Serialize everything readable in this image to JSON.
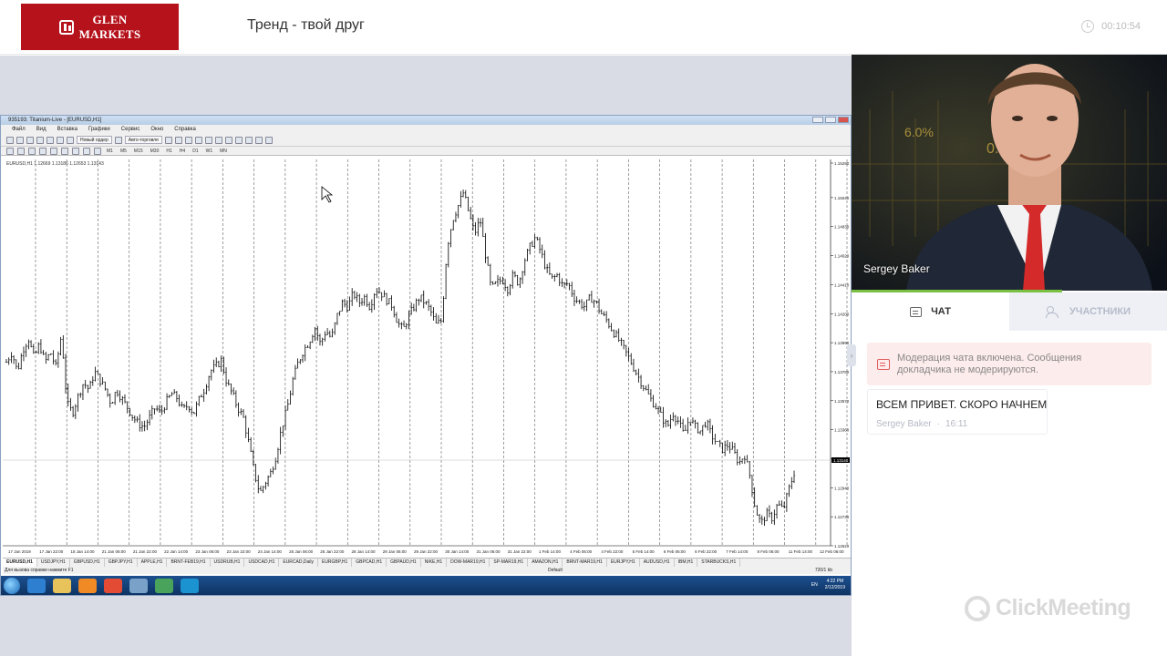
{
  "header": {
    "logo_line1": "GLEN",
    "logo_line2": "MARKETS",
    "title": "Тренд - твой друг",
    "timer": "00:10:54",
    "timer_icon": "clock-icon"
  },
  "terminal": {
    "window_title": "935193: Titanium-Live - [EURUSD,H1]",
    "menu": [
      "Файл",
      "Вид",
      "Вставка",
      "Графики",
      "Сервис",
      "Окно",
      "Справка"
    ],
    "toolbar": {
      "new_order": "Новый ордер",
      "auto_trading": "Авто-торговля"
    },
    "timeframes": [
      "M1",
      "M5",
      "M15",
      "M30",
      "H1",
      "H4",
      "D1",
      "W1",
      "MN"
    ],
    "chart_info": "EURUSD,H1 1.12669 1.13186 1.12653 1.13143",
    "symbol_tabs": [
      "EURUSD,H1",
      "USDJPY,H1",
      "GBPUSD,H1",
      "GBPJPY,H1",
      "APPLE,H1",
      "BRNT-FEB19,H1",
      "USDRUB,H1",
      "USDCAD,H1",
      "EURCAD,Daily",
      "EURGBP,H1",
      "GBPCAD,H1",
      "GBPAUD,H1",
      "NIKE,H1",
      "DOW-MAR19,H1",
      "SP-MAR19,H1",
      "AMAZON,H1",
      "BRNT-MAR19,H1",
      "EURJPY,H1",
      "AUDUSD,H1",
      "IBM,H1",
      "STARBUCKS,H1"
    ],
    "status_help": "Для вызова справки нажмите F1",
    "status_profile": "Default",
    "status_traffic": "720/1 kb",
    "tray_lang": "EN",
    "tray_time": "4:22 PM",
    "tray_date": "2/12/2019"
  },
  "chart_data": {
    "type": "line",
    "series_kind": "ohlc-bars",
    "y_ticks": [
      1.1529,
      1.1504,
      1.1483,
      1.1462,
      1.1441,
      1.142,
      1.1399,
      1.1378,
      1.1357,
      1.1336,
      1.1315,
      1.1294,
      1.1273,
      1.1252
    ],
    "x_ticks": [
      "17 Jan 2019",
      "17 Jan 22:00",
      "18 Jan 14:00",
      "21 Jan 06:00",
      "21 Jan 22:00",
      "22 Jan 14:00",
      "23 Jan 06:00",
      "23 Jan 22:00",
      "24 Jan 14:00",
      "25 Jan 06:00",
      "25 Jan 22:00",
      "28 Jan 14:00",
      "29 Jan 06:00",
      "29 Jan 22:00",
      "30 Jan 14:00",
      "31 Jan 06:00",
      "31 Jan 22:00",
      "1 Feb 14:00",
      "4 Feb 06:00",
      "4 Feb 22:00",
      "5 Feb 14:00",
      "6 Feb 06:00",
      "6 Feb 22:00",
      "7 Feb 14:00",
      "8 Feb 06:00",
      "11 Feb 14:00",
      "12 Feb 06:00"
    ],
    "close_values": [
      1.1385,
      1.1392,
      1.1378,
      1.1394,
      1.1402,
      1.1388,
      1.1398,
      1.1385,
      1.1392,
      1.1381,
      1.1405,
      1.1355,
      1.1348,
      1.136,
      1.137,
      1.1365,
      1.1378,
      1.1372,
      1.1365,
      1.1355,
      1.1365,
      1.1358,
      1.1352,
      1.1345,
      1.134,
      1.1338,
      1.1345,
      1.1352,
      1.1348,
      1.1356,
      1.1362,
      1.1359,
      1.135,
      1.1354,
      1.1348,
      1.1358,
      1.1366,
      1.1378,
      1.1382,
      1.1386,
      1.137,
      1.1362,
      1.1352,
      1.1345,
      1.1326,
      1.1305,
      1.129,
      1.1298,
      1.1305,
      1.1318,
      1.1338,
      1.1352,
      1.1372,
      1.1385,
      1.1394,
      1.14,
      1.141,
      1.1398,
      1.1408,
      1.1402,
      1.1418,
      1.1428,
      1.1425,
      1.1435,
      1.1428,
      1.1432,
      1.1425,
      1.1438,
      1.1435,
      1.143,
      1.1426,
      1.1414,
      1.1408,
      1.1418,
      1.1425,
      1.1432,
      1.1428,
      1.1422,
      1.1412,
      1.1415,
      1.1468,
      1.1488,
      1.1498,
      1.1508,
      1.1492,
      1.1478,
      1.1488,
      1.1462,
      1.1438,
      1.1442,
      1.1445,
      1.1438,
      1.1448,
      1.1442,
      1.1458,
      1.1468,
      1.1475,
      1.1465,
      1.1452,
      1.1445,
      1.1448,
      1.144,
      1.1442,
      1.1432,
      1.1428,
      1.1425,
      1.1432,
      1.1428,
      1.142,
      1.1415,
      1.1408,
      1.1402,
      1.1395,
      1.1388,
      1.138,
      1.1372,
      1.1365,
      1.1358,
      1.1352,
      1.1345,
      1.1338,
      1.1348,
      1.1342,
      1.1332,
      1.1345,
      1.1338,
      1.1335,
      1.1342,
      1.1332,
      1.1326,
      1.1322,
      1.1325,
      1.132,
      1.1312,
      1.1318,
      1.1302,
      1.1278,
      1.1268,
      1.1275,
      1.1272,
      1.1282,
      1.1278,
      1.1292,
      1.1305
    ],
    "last_price": 1.1314,
    "grid": true
  },
  "presenter": {
    "name": "Sergey Baker"
  },
  "tabs": {
    "chat": "ЧАТ",
    "participants": "УЧАСТНИКИ"
  },
  "chat": {
    "notice": "Модерация чата включена. Сообщения докладчика не модерируются.",
    "messages": [
      {
        "text": "ВСЕМ ПРИВЕТ. СКОРО НАЧНЕМ",
        "author": "Sergey Baker",
        "time": "16:11"
      }
    ]
  },
  "brand": "ClickMeeting",
  "colors": {
    "logo_red": "#b5121b",
    "accent_green": "#7ac143",
    "notice_bg": "#fdecec"
  }
}
